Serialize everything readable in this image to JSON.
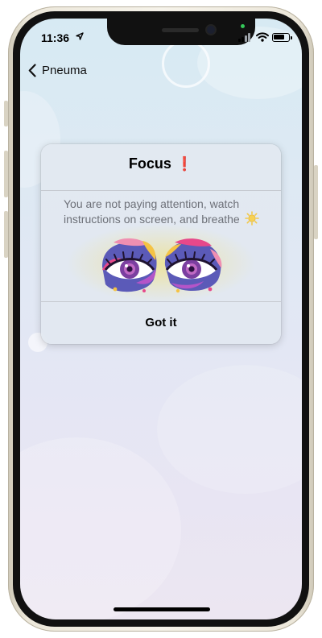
{
  "status_bar": {
    "time": "11:36",
    "location_icon": "location-arrow-icon",
    "signal_icon": "cellular-signal-icon",
    "wifi_icon": "wifi-icon",
    "battery_icon": "battery-icon"
  },
  "nav": {
    "back_label": "Pneuma",
    "back_icon": "chevron-left-icon"
  },
  "alert": {
    "title": "Focus",
    "title_emoji": "❗",
    "message": "You are not paying attention, watch instructions on screen, and breathe",
    "message_icon": "sun-icon",
    "illustration": "eyes-illustration",
    "button_label": "Got it"
  },
  "colors": {
    "accent_red": "#e0242a",
    "alert_background": "#e2e8f0",
    "message_text": "#6d7078"
  }
}
